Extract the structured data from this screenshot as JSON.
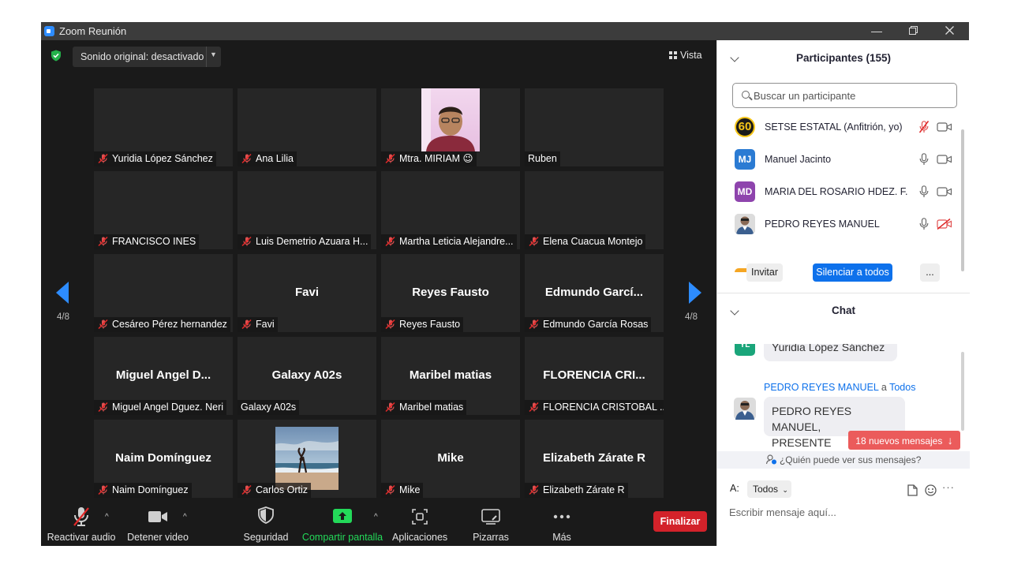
{
  "window": {
    "title": "Zoom Reunión"
  },
  "video": {
    "sound_label": "Sonido original: desactivado",
    "view_label": "Vista",
    "page_left": "4/8",
    "page_right": "4/8",
    "tiles": [
      {
        "display": "",
        "name": "Yuridia López Sánchez",
        "muted": true
      },
      {
        "display": "",
        "name": "Ana Lilia",
        "muted": true
      },
      {
        "display": "",
        "name": "Mtra. MIRIAM 😉",
        "muted": true,
        "video": "person-photo"
      },
      {
        "display": "",
        "name": "Ruben",
        "muted": false
      },
      {
        "display": "",
        "name": "FRANCISCO INES",
        "muted": true
      },
      {
        "display": "",
        "name": "Luis Demetrio Azuara H...",
        "muted": true
      },
      {
        "display": "",
        "name": "Martha Leticia Alejandre...",
        "muted": true
      },
      {
        "display": "",
        "name": "Elena Cuacua Montejo",
        "muted": true
      },
      {
        "display": "",
        "name": "Cesáreo Pérez hernandez",
        "muted": true
      },
      {
        "display": "Favi",
        "name": "Favi",
        "muted": true
      },
      {
        "display": "Reyes Fausto",
        "name": "Reyes Fausto",
        "muted": true
      },
      {
        "display": "Edmundo  Garcí...",
        "name": "Edmundo García Rosas",
        "muted": true
      },
      {
        "display": "Miguel  Angel  D...",
        "name": "Miguel Angel Dguez. Neri",
        "muted": true
      },
      {
        "display": "Galaxy A02s",
        "name": "Galaxy A02s",
        "muted": false
      },
      {
        "display": "Maribel matias",
        "name": "Maribel matias",
        "muted": true
      },
      {
        "display": "FLORENCIA  CRI...",
        "name": "FLORENCIA CRISTOBAL ...",
        "muted": true
      },
      {
        "display": "Naim Domínguez",
        "name": "Naim Domínguez",
        "muted": true
      },
      {
        "display": "",
        "name": "Carlos Ortiz",
        "muted": true,
        "video": "beach-photo"
      },
      {
        "display": "Mike",
        "name": "Mike",
        "muted": true
      },
      {
        "display": "Elizabeth Zárate R",
        "name": "Elizabeth Zárate R",
        "muted": true
      }
    ]
  },
  "toolbar": {
    "audio": "Reactivar audio",
    "video": "Detener video",
    "security": "Seguridad",
    "share": "Compartir pantalla",
    "apps": "Aplicaciones",
    "whiteboards": "Pizarras",
    "more": "Más",
    "end": "Finalizar"
  },
  "participants": {
    "header": "Participantes (155)",
    "search_placeholder": "Buscar un participante",
    "list": [
      {
        "avatar": "60",
        "avatar_color": "#1a1a1a",
        "name": "SETSE ESTATAL (Anfitrión, yo)",
        "mic_muted": true,
        "cam_off": false
      },
      {
        "avatar": "MJ",
        "avatar_color": "#2b7bd3",
        "name": "Manuel Jacinto",
        "mic_muted": false,
        "cam_off": false
      },
      {
        "avatar": "MD",
        "avatar_color": "#8e44ad",
        "name": "MARIA DEL ROSARIO HDEZ. F.",
        "mic_muted": false,
        "cam_off": false
      },
      {
        "avatar": "",
        "avatar_color": "#dcdcdc",
        "name": "PEDRO REYES MANUEL",
        "mic_muted": false,
        "cam_off": true
      }
    ],
    "invite": "Invitar",
    "mute_all": "Silenciar a todos",
    "more": "..."
  },
  "chat": {
    "header": "Chat",
    "prev_avatar": "YL",
    "prev_message": "Yuridia López Sánchez",
    "sender": "PEDRO REYES MANUEL",
    "to_word": "a",
    "recipient": "Todos",
    "message_line1": "PEDRO REYES MANUEL,",
    "message_line2": "PRESENTE",
    "new_messages": "18 nuevos mensajes",
    "who_can_see": "¿Quién puede ver sus mensajes?",
    "to_label": "A:",
    "to_value": "Todos",
    "input_placeholder": "Escribir mensaje aquí...",
    "more": "···"
  },
  "colors": {
    "accent": "#0e71eb",
    "share_green": "#23d959",
    "end_red": "#d3222a",
    "muted_red": "#e02828"
  }
}
